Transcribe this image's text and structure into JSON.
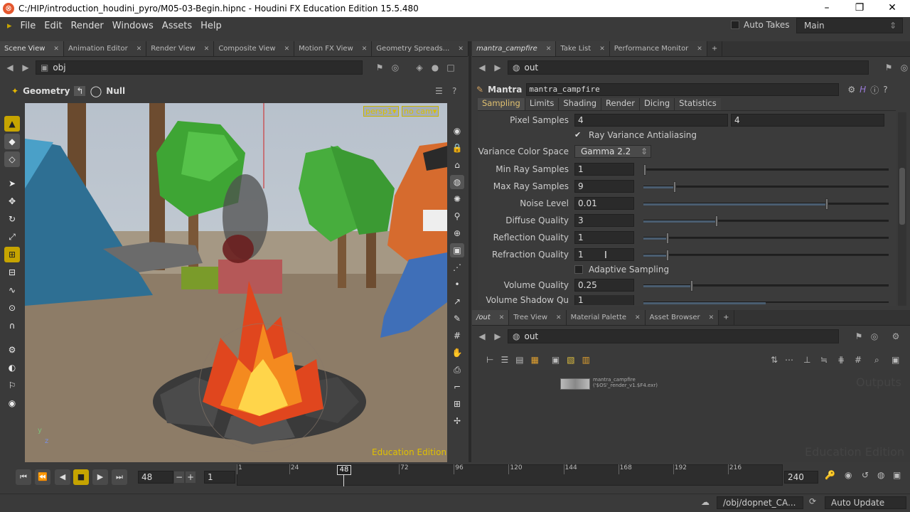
{
  "window": {
    "title": "C:/HIP/introduction_houdini_pyro/M05-03-Begin.hipnc - Houdini FX Education Edition 15.5.480",
    "min": "–",
    "max": "❐",
    "close": "✕"
  },
  "menu": [
    "File",
    "Edit",
    "Render",
    "Windows",
    "Assets",
    "Help"
  ],
  "auto_takes": "Auto Takes",
  "desktop": "Main",
  "left_tabs": [
    "Scene View",
    "Animation Editor",
    "Render View",
    "Composite View",
    "Motion FX View",
    "Geometry Spreads..."
  ],
  "left_path": "obj",
  "viewer": {
    "context": "Geometry",
    "selection": "Null",
    "camera": "persp1▾",
    "cam2": "no cam▾",
    "watermark": "Education Edition",
    "axis_y": "y",
    "axis_z": "z"
  },
  "right_tabs": [
    "mantra_campfire",
    "Take List",
    "Performance Monitor"
  ],
  "right_path": "out",
  "node": {
    "type": "Mantra",
    "name": "mantra_campfire"
  },
  "param_tabs": [
    "Sampling",
    "Limits",
    "Shading",
    "Render",
    "Dicing",
    "Statistics"
  ],
  "params": {
    "pixel_samples_label": "Pixel Samples",
    "pixel_samples_a": "4",
    "pixel_samples_b": "4",
    "ray_var_label": "Ray Variance Antialiasing",
    "ray_var_check": "✔",
    "color_space_label": "Variance Color Space",
    "color_space_value": "Gamma 2.2",
    "min_ray_label": "Min Ray Samples",
    "min_ray_value": "1",
    "max_ray_label": "Max Ray Samples",
    "max_ray_value": "9",
    "noise_label": "Noise Level",
    "noise_value": "0.01",
    "diffuse_label": "Diffuse Quality",
    "diffuse_value": "3",
    "reflection_label": "Reflection Quality",
    "reflection_value": "1",
    "refraction_label": "Refraction Quality",
    "refraction_value": "1",
    "adaptive_label": "Adaptive Sampling",
    "volume_label": "Volume Quality",
    "volume_value": "0.25",
    "volshadow_label": "Volume Shadow Qu",
    "volshadow_value": "1"
  },
  "net_tabs": [
    "/out",
    "Tree View",
    "Material Palette",
    "Asset Browser"
  ],
  "net_path": "out",
  "net_node": {
    "name": "mantra_campfire",
    "sub": "('$OS'_render_v1.$F4.exr)"
  },
  "net_watermark": "Outputs",
  "net_edu": "Education Edition",
  "timeline": {
    "frame": "48",
    "start": "1",
    "end": "240",
    "current_marker": "48",
    "ticks": [
      "1",
      "24",
      "48",
      "72",
      "96",
      "120",
      "144",
      "168",
      "192",
      "216"
    ]
  },
  "status": {
    "path": "/obj/dopnet_CA...",
    "update": "Auto Update"
  }
}
